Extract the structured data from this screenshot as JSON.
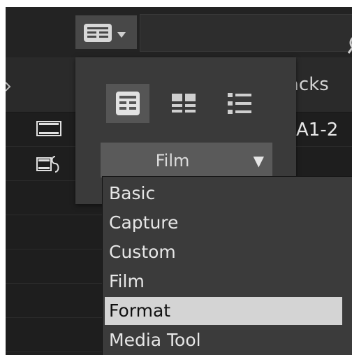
{
  "toolbar": {
    "view_button": {
      "icon": "grid-view-icon",
      "menu_icon": "chevron-down-icon"
    },
    "search_icon": "search-icon"
  },
  "table": {
    "column_header_partial": "acks",
    "rows": [
      {
        "icon": "film-strip-icon",
        "value": "A1-2"
      },
      {
        "icon": "linked-clip-icon",
        "value": ""
      }
    ]
  },
  "view_popup": {
    "view_modes": [
      {
        "name": "frame-view-icon",
        "active": true
      },
      {
        "name": "script-view-icon",
        "active": false
      },
      {
        "name": "list-view-icon",
        "active": false
      }
    ],
    "column_set": {
      "selected": "Film",
      "arrow": "▼"
    }
  },
  "column_set_menu": {
    "items": [
      "Basic",
      "Capture",
      "Custom",
      "Film",
      "Format",
      "Media Tool"
    ],
    "highlighted": "Format"
  },
  "colors": {
    "background": "#1f1f1f",
    "popup": "#3a3a3a",
    "highlight": "#d4d4d4"
  }
}
